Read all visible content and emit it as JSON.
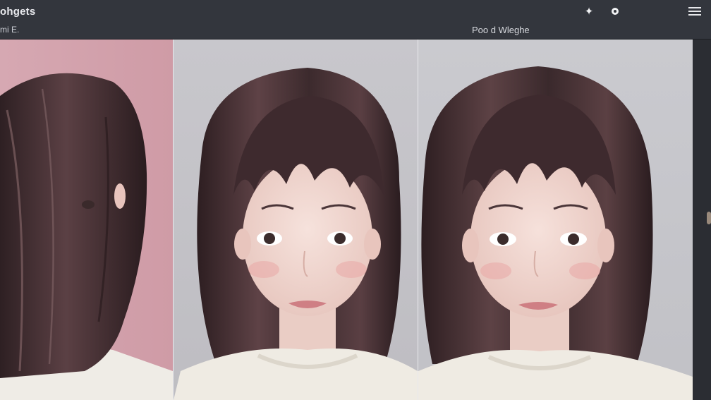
{
  "header": {
    "app_title": "ohgets",
    "left_subtitle": "mi E.",
    "center_subtitle": "Poo d Wleghe",
    "icons": [
      "sparkle-icon",
      "circle-icon",
      "hamburger-menu-icon"
    ]
  },
  "gallery": {
    "panels": [
      {
        "name": "portrait-1",
        "background": "#d6a8b2"
      },
      {
        "name": "portrait-2",
        "background": "#c8c7cc"
      },
      {
        "name": "portrait-3",
        "background": "#cacacf"
      }
    ]
  },
  "colors": {
    "topbar": "#33363d",
    "text_primary": "#e9eaee",
    "hair": "#3a2a2c",
    "skin": "#f0d6cf"
  }
}
